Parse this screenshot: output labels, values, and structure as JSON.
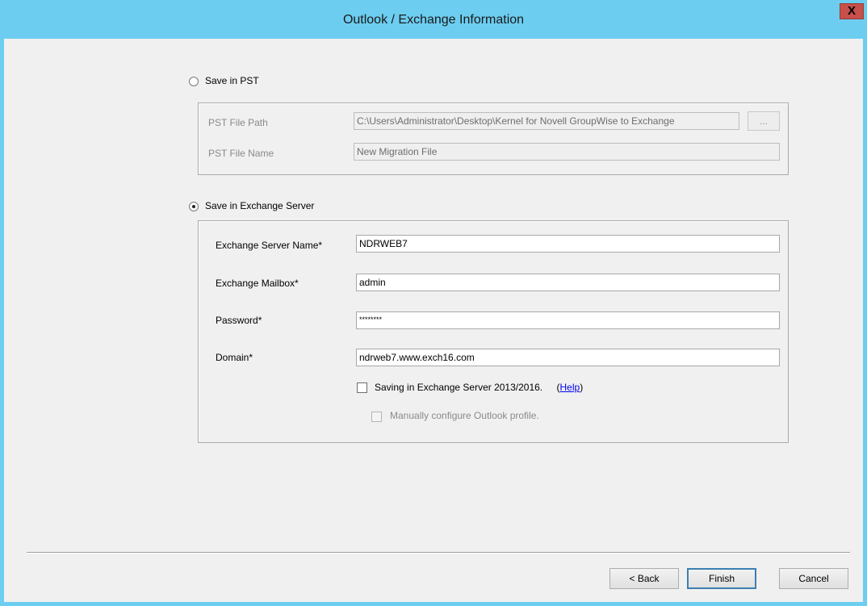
{
  "window": {
    "title": "Outlook / Exchange Information",
    "close_label": "X"
  },
  "pst": {
    "radio_label": "Save in PST",
    "selected": false,
    "file_path_label": "PST File Path",
    "file_path_value": "C:\\Users\\Administrator\\Desktop\\Kernel for Novell GroupWise to Exchange",
    "browse_label": "...",
    "file_name_label": "PST File Name",
    "file_name_value": "New Migration File"
  },
  "exchange": {
    "radio_label": "Save in Exchange Server",
    "selected": true,
    "server_name_label": "Exchange Server Name*",
    "server_name_value": "NDRWEB7",
    "mailbox_label": "Exchange Mailbox*",
    "mailbox_value": "admin",
    "password_label": "Password*",
    "password_value": "********",
    "domain_label": "Domain*",
    "domain_value": "ndrweb7.www.exch16.com",
    "save_2013_label": "Saving in Exchange Server 2013/2016.",
    "help_open": "(",
    "help_link": "Help",
    "help_close": ")",
    "manual_config_label": "Manually configure Outlook profile."
  },
  "footer": {
    "back_label": "< Back",
    "finish_label": "Finish",
    "cancel_label": "Cancel"
  }
}
